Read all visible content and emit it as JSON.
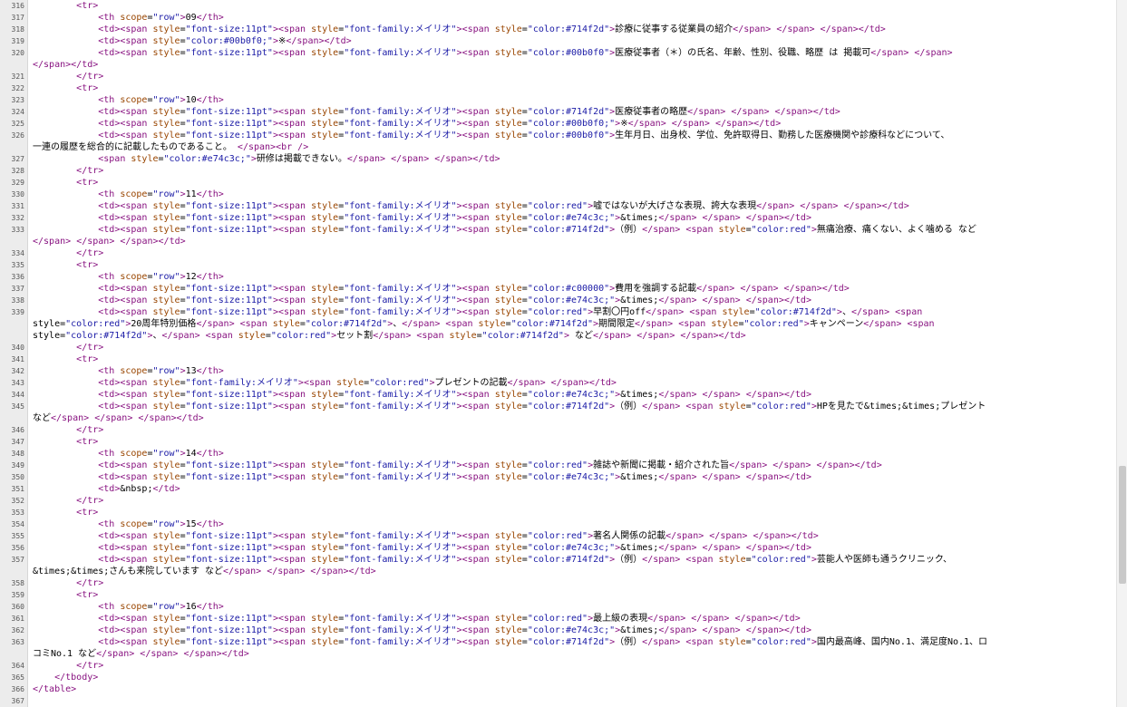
{
  "editor": {
    "scroll_position": 0.79,
    "lines": [
      {
        "n": "316",
        "text": "        <tr>"
      },
      {
        "n": "317",
        "text": "            <th scope=\"row\">09</th>"
      },
      {
        "n": "318",
        "text": "            <td><span style=\"font-size:11pt\"><span style=\"font-family:メイリオ\"><span style=\"color:#714f2d\">診療に従事する従業員の紹介</span> </span> </span></td>"
      },
      {
        "n": "319",
        "text": "            <td><span style=\"color:#00b0f0;\">※</span></td>"
      },
      {
        "n": "320",
        "text": "            <td><span style=\"font-size:11pt\"><span style=\"font-family:メイリオ\"><span style=\"color:#00b0f0\">医療従事者（＊）の氏名、年齢、性別、役職、略歴 は 掲載可</span> </span>"
      },
      {
        "n": "",
        "text": "</span></td>"
      },
      {
        "n": "321",
        "text": "        </tr>"
      },
      {
        "n": "322",
        "text": "        <tr>"
      },
      {
        "n": "323",
        "text": "            <th scope=\"row\">10</th>"
      },
      {
        "n": "324",
        "text": "            <td><span style=\"font-size:11pt\"><span style=\"font-family:メイリオ\"><span style=\"color:#714f2d\">医療従事者の略歴</span> </span> </span></td>"
      },
      {
        "n": "325",
        "text": "            <td><span style=\"font-size:11pt\"><span style=\"font-family:メイリオ\"><span style=\"color:#00b0f0;\">※</span> </span> </span></td>"
      },
      {
        "n": "326",
        "text": "            <td><span style=\"font-size:11pt\"><span style=\"font-family:メイリオ\"><span style=\"color:#00b0f0\">生年月日、出身校、学位、免許取得日、勤務した医療機関や診療科などについて、"
      },
      {
        "n": "",
        "text": "一連の履歴を総合的に記載したものであること。 </span><br />"
      },
      {
        "n": "327",
        "text": "            <span style=\"color:#e74c3c;\">研修は掲載できない。</span> </span> </span></td>"
      },
      {
        "n": "328",
        "text": "        </tr>"
      },
      {
        "n": "329",
        "text": "        <tr>"
      },
      {
        "n": "330",
        "text": "            <th scope=\"row\">11</th>"
      },
      {
        "n": "331",
        "text": "            <td><span style=\"font-size:11pt\"><span style=\"font-family:メイリオ\"><span style=\"color:red\">嘘ではないが大げさな表現、誇大な表現</span> </span> </span></td>"
      },
      {
        "n": "332",
        "text": "            <td><span style=\"font-size:11pt\"><span style=\"font-family:メイリオ\"><span style=\"color:#e74c3c;\">&times;</span> </span> </span></td>"
      },
      {
        "n": "333",
        "text": "            <td><span style=\"font-size:11pt\"><span style=\"font-family:メイリオ\"><span style=\"color:#714f2d\">（例）</span> <span style=\"color:red\">無痛治療、痛くない、よく噛める など"
      },
      {
        "n": "",
        "text": "</span> </span> </span></td>"
      },
      {
        "n": "334",
        "text": "        </tr>"
      },
      {
        "n": "335",
        "text": "        <tr>"
      },
      {
        "n": "336",
        "text": "            <th scope=\"row\">12</th>"
      },
      {
        "n": "337",
        "text": "            <td><span style=\"font-size:11pt\"><span style=\"font-family:メイリオ\"><span style=\"color:#c00000\">費用を強調する記載</span> </span> </span></td>"
      },
      {
        "n": "338",
        "text": "            <td><span style=\"font-size:11pt\"><span style=\"font-family:メイリオ\"><span style=\"color:#e74c3c;\">&times;</span> </span> </span></td>"
      },
      {
        "n": "339",
        "text": "            <td><span style=\"font-size:11pt\"><span style=\"font-family:メイリオ\"><span style=\"color:red\">早割〇円off</span> <span style=\"color:#714f2d\">、</span> <span"
      },
      {
        "n": "",
        "text": "style=\"color:red\">20周年特別価格</span> <span style=\"color:#714f2d\">、</span> <span style=\"color:#714f2d\">期間限定</span> <span style=\"color:red\">キャンペーン</span> <span"
      },
      {
        "n": "",
        "text": "style=\"color:#714f2d\">、</span> <span style=\"color:red\">セット割</span> <span style=\"color:#714f2d\"> など</span> </span> </span></td>"
      },
      {
        "n": "340",
        "text": "        </tr>"
      },
      {
        "n": "341",
        "text": "        <tr>"
      },
      {
        "n": "342",
        "text": "            <th scope=\"row\">13</th>"
      },
      {
        "n": "343",
        "text": "            <td><span style=\"font-family:メイリオ\"><span style=\"color:red\">プレゼントの記載</span> </span></td>"
      },
      {
        "n": "344",
        "text": "            <td><span style=\"font-size:11pt\"><span style=\"font-family:メイリオ\"><span style=\"color:#e74c3c;\">&times;</span> </span> </span></td>"
      },
      {
        "n": "345",
        "text": "            <td><span style=\"font-size:11pt\"><span style=\"font-family:メイリオ\"><span style=\"color:#714f2d\">（例）</span> <span style=\"color:red\">HPを見たで&times;&times;プレゼント"
      },
      {
        "n": "",
        "text": "など</span> </span> </span></td>"
      },
      {
        "n": "346",
        "text": "        </tr>"
      },
      {
        "n": "347",
        "text": "        <tr>"
      },
      {
        "n": "348",
        "text": "            <th scope=\"row\">14</th>"
      },
      {
        "n": "349",
        "text": "            <td><span style=\"font-size:11pt\"><span style=\"font-family:メイリオ\"><span style=\"color:red\">雑誌や新聞に掲載・紹介された旨</span> </span> </span></td>"
      },
      {
        "n": "350",
        "text": "            <td><span style=\"font-size:11pt\"><span style=\"font-family:メイリオ\"><span style=\"color:#e74c3c;\">&times;</span> </span> </span></td>"
      },
      {
        "n": "351",
        "text": "            <td>&nbsp;</td>"
      },
      {
        "n": "352",
        "text": "        </tr>"
      },
      {
        "n": "353",
        "text": "        <tr>"
      },
      {
        "n": "354",
        "text": "            <th scope=\"row\">15</th>"
      },
      {
        "n": "355",
        "text": "            <td><span style=\"font-size:11pt\"><span style=\"font-family:メイリオ\"><span style=\"color:red\">著名人関係の記載</span> </span> </span></td>"
      },
      {
        "n": "356",
        "text": "            <td><span style=\"font-size:11pt\"><span style=\"font-family:メイリオ\"><span style=\"color:#e74c3c;\">&times;</span> </span> </span></td>"
      },
      {
        "n": "357",
        "text": "            <td><span style=\"font-size:11pt\"><span style=\"font-family:メイリオ\"><span style=\"color:#714f2d\">（例）</span> <span style=\"color:red\">芸能人や医師も通うクリニック、"
      },
      {
        "n": "",
        "text": "&times;&times;さんも来院しています など</span> </span> </span></td>"
      },
      {
        "n": "358",
        "text": "        </tr>"
      },
      {
        "n": "359",
        "text": "        <tr>"
      },
      {
        "n": "360",
        "text": "            <th scope=\"row\">16</th>"
      },
      {
        "n": "361",
        "text": "            <td><span style=\"font-size:11pt\"><span style=\"font-family:メイリオ\"><span style=\"color:red\">最上級の表現</span> </span> </span></td>"
      },
      {
        "n": "362",
        "text": "            <td><span style=\"font-size:11pt\"><span style=\"font-family:メイリオ\"><span style=\"color:#e74c3c;\">&times;</span> </span> </span></td>"
      },
      {
        "n": "363",
        "text": "            <td><span style=\"font-size:11pt\"><span style=\"font-family:メイリオ\"><span style=\"color:#714f2d\">（例）</span> <span style=\"color:red\">国内最高峰、国内No.1、満足度No.1、ロ"
      },
      {
        "n": "",
        "text": "コミNo.1 など</span> </span> </span></td>"
      },
      {
        "n": "364",
        "text": "        </tr>"
      },
      {
        "n": "365",
        "text": "    </tbody>"
      },
      {
        "n": "366",
        "text": "</table>"
      },
      {
        "n": "367",
        "text": ""
      }
    ]
  }
}
